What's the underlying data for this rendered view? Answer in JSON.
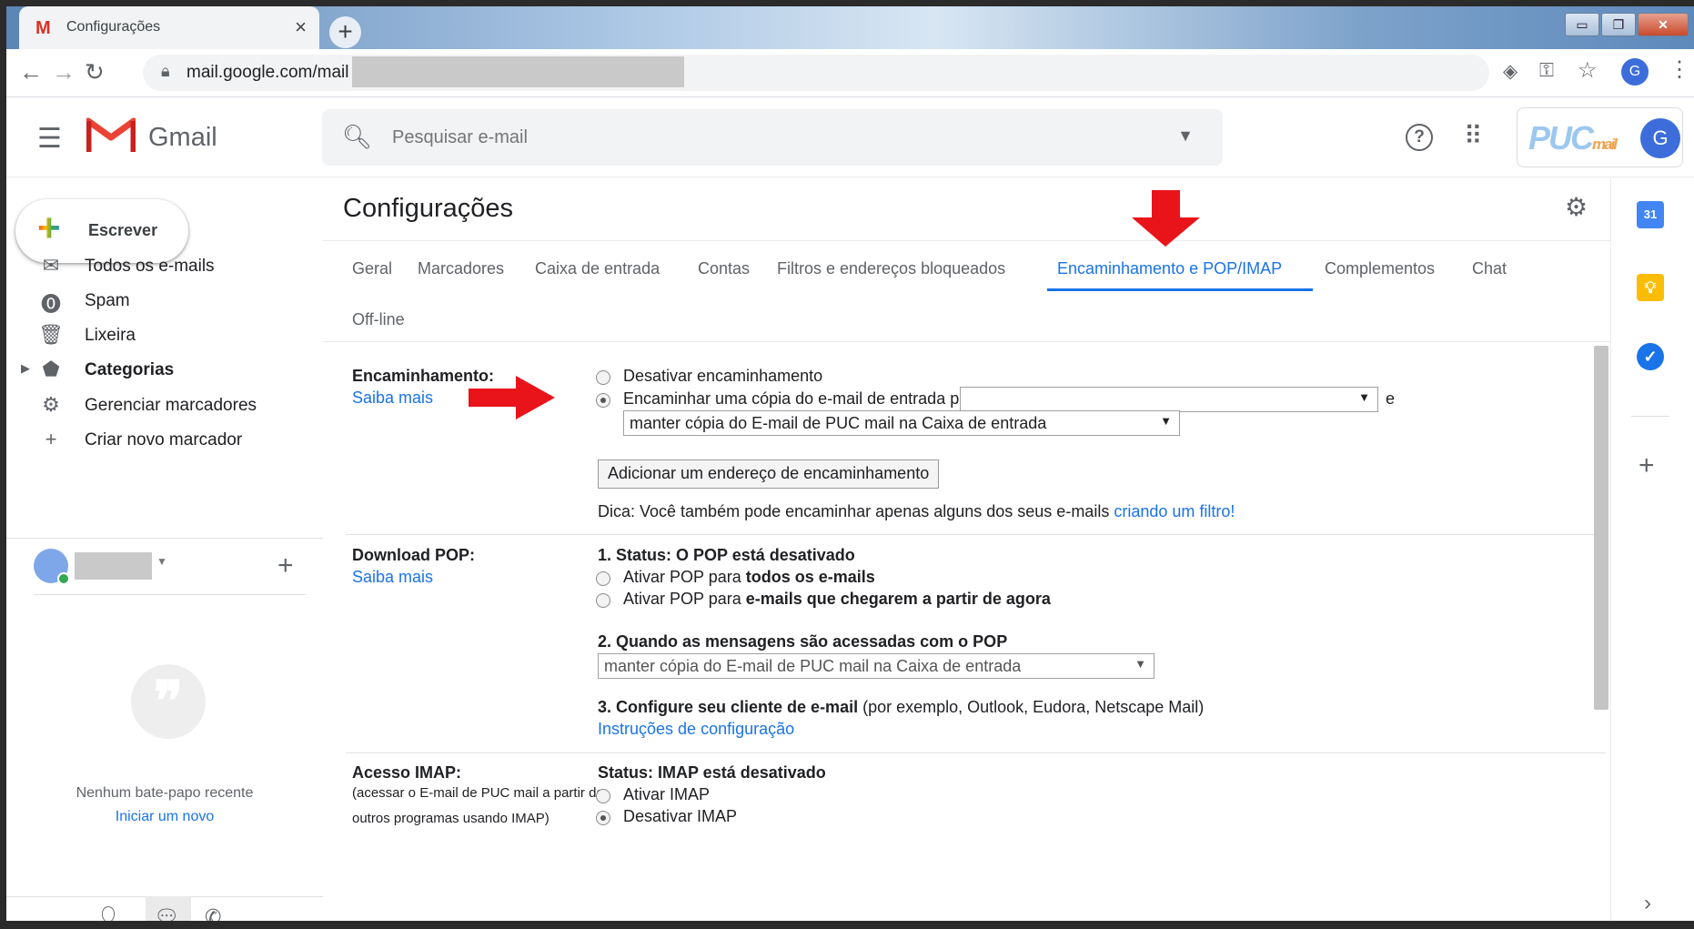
{
  "browser": {
    "tab_title": "Configurações",
    "tab_favicon": "M",
    "tab_close": "×",
    "new_tab": "+",
    "url": "mail.google.com/mail",
    "profile_initial": "G",
    "window_buttons": {
      "minimize": "▭",
      "restore": "❐",
      "close": "✕"
    }
  },
  "header": {
    "brand": "Gmail",
    "search_placeholder": "Pesquisar e-mail",
    "account_logo": "PUC",
    "account_logo_suffix": "mail",
    "account_initial": "G"
  },
  "sidebar": {
    "compose_label": "Escrever",
    "items": [
      {
        "label": "Todos os e-mails",
        "icon": "mail-icon"
      },
      {
        "label": "Spam",
        "icon": "spam-icon"
      },
      {
        "label": "Lixeira",
        "icon": "trash-icon"
      },
      {
        "label": "Categorias",
        "icon": "label-icon"
      },
      {
        "label": "Gerenciar marcadores",
        "icon": "gear-icon"
      },
      {
        "label": "Criar novo marcador",
        "icon": "plus-icon"
      }
    ],
    "no_chat": "Nenhum bate-papo recente",
    "start_chat": "Iniciar um novo"
  },
  "settings": {
    "title": "Configurações",
    "tabs": [
      "Geral",
      "Marcadores",
      "Caixa de entrada",
      "Contas",
      "Filtros e endereços bloqueados",
      "Encaminhamento e POP/IMAP",
      "Complementos",
      "Chat",
      "Off-line"
    ],
    "active_tab": "Encaminhamento e POP/IMAP",
    "forwarding": {
      "label": "Encaminhamento:",
      "learn_more": "Saiba mais",
      "disable": "Desativar encaminhamento",
      "forward_copy": "Encaminhar uma cópia do e-mail de entrada para",
      "forward_to_value": "",
      "and": "e",
      "keep_option": "manter cópia do E-mail de PUC mail na Caixa de entrada",
      "add_address_button": "Adicionar um endereço de encaminhamento",
      "tip": "Dica: Você também pode encaminhar apenas alguns dos seus e-mails",
      "tip_link": "criando um filtro!"
    },
    "pop": {
      "label": "Download POP:",
      "learn_more": "Saiba mais",
      "status": "1. Status: O POP está desativado",
      "enable_all_pre": "Ativar POP para ",
      "enable_all_bold": "todos os e-mails",
      "enable_new_pre": "Ativar POP para ",
      "enable_new_bold": "e-mails que chegarem a partir de agora",
      "when_accessed": "2. Quando as mensagens são acessadas com o POP",
      "when_accessed_value": "manter cópia do E-mail de PUC mail na Caixa de entrada",
      "configure_bold": "3. Configure seu cliente de e-mail",
      "configure_rest": " (por exemplo, Outlook, Eudora, Netscape Mail)",
      "instructions": "Instruções de configuração"
    },
    "imap": {
      "label": "Acesso IMAP:",
      "sublabel": "(acessar o E-mail de PUC mail a partir de outros programas usando IMAP)",
      "status": "Status: IMAP está desativado",
      "enable": "Ativar IMAP",
      "disable": "Desativar IMAP"
    }
  },
  "colors": {
    "accent": "#1a73e8",
    "annotation_arrow": "#e8141a",
    "gmail_red": "#ea4335"
  }
}
